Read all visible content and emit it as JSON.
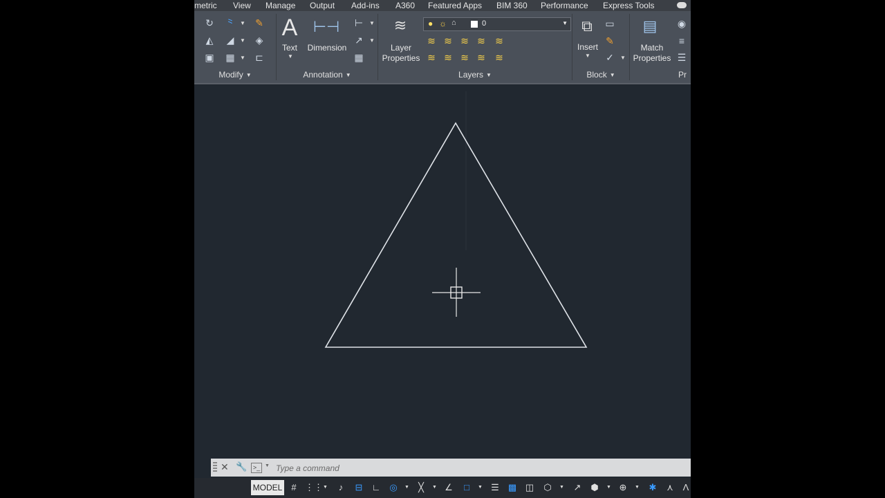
{
  "menu_tabs": [
    "metric",
    "View",
    "Manage",
    "Output",
    "Add-ins",
    "A360",
    "Featured Apps",
    "BIM 360",
    "Performance",
    "Express Tools"
  ],
  "panels": {
    "modify": "Modify",
    "annotation": "Annotation",
    "layers": "Layers",
    "block": "Block",
    "properties_partial": "Pr"
  },
  "buttons": {
    "text": "Text",
    "dimension": "Dimension",
    "layer_properties_line1": "Layer",
    "layer_properties_line2": "Properties",
    "insert": "Insert",
    "match_properties_line1": "Match",
    "match_properties_line2": "Properties"
  },
  "layer_combo": {
    "current_layer": "0"
  },
  "command_line": {
    "placeholder": "Type a command"
  },
  "status_bar": {
    "model": "MODEL"
  },
  "icons": {
    "text_glyph": "A",
    "accent": "#4aa3ff",
    "canvas_bg": "#212830"
  }
}
